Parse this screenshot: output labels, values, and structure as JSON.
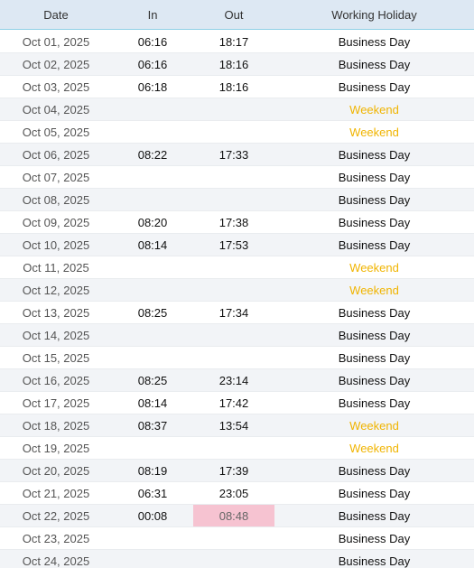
{
  "header": {
    "date": "Date",
    "in": "In",
    "out": "Out",
    "holiday": "Working Holiday"
  },
  "colors": {
    "header_bg": "#dde8f3",
    "header_border": "#8fd0e6",
    "weekend": "#f0b400",
    "flag": "#f6c3d1"
  },
  "rows": [
    {
      "date": "Oct 01, 2025",
      "in": "06:16",
      "out": "18:17",
      "holiday": "Business Day"
    },
    {
      "date": "Oct 02, 2025",
      "in": "06:16",
      "out": "18:16",
      "holiday": "Business Day"
    },
    {
      "date": "Oct 03, 2025",
      "in": "06:18",
      "out": "18:16",
      "holiday": "Business Day"
    },
    {
      "date": "Oct 04, 2025",
      "in": "",
      "out": "",
      "holiday": "Weekend"
    },
    {
      "date": "Oct 05, 2025",
      "in": "",
      "out": "",
      "holiday": "Weekend"
    },
    {
      "date": "Oct 06, 2025",
      "in": "08:22",
      "out": "17:33",
      "holiday": "Business Day"
    },
    {
      "date": "Oct 07, 2025",
      "in": "",
      "out": "",
      "holiday": "Business Day"
    },
    {
      "date": "Oct 08, 2025",
      "in": "",
      "out": "",
      "holiday": "Business Day"
    },
    {
      "date": "Oct 09, 2025",
      "in": "08:20",
      "out": "17:38",
      "holiday": "Business Day"
    },
    {
      "date": "Oct 10, 2025",
      "in": "08:14",
      "out": "17:53",
      "holiday": "Business Day"
    },
    {
      "date": "Oct 11, 2025",
      "in": "",
      "out": "",
      "holiday": "Weekend"
    },
    {
      "date": "Oct 12, 2025",
      "in": "",
      "out": "",
      "holiday": "Weekend"
    },
    {
      "date": "Oct 13, 2025",
      "in": "08:25",
      "out": "17:34",
      "holiday": "Business Day"
    },
    {
      "date": "Oct 14, 2025",
      "in": "",
      "out": "",
      "holiday": "Business Day"
    },
    {
      "date": "Oct 15, 2025",
      "in": "",
      "out": "",
      "holiday": "Business Day"
    },
    {
      "date": "Oct 16, 2025",
      "in": "08:25",
      "out": "23:14",
      "holiday": "Business Day"
    },
    {
      "date": "Oct 17, 2025",
      "in": "08:14",
      "out": "17:42",
      "holiday": "Business Day"
    },
    {
      "date": "Oct 18, 2025",
      "in": "08:37",
      "out": "13:54",
      "holiday": "Weekend"
    },
    {
      "date": "Oct 19, 2025",
      "in": "",
      "out": "",
      "holiday": "Weekend"
    },
    {
      "date": "Oct 20, 2025",
      "in": "08:19",
      "out": "17:39",
      "holiday": "Business Day"
    },
    {
      "date": "Oct 21, 2025",
      "in": "06:31",
      "out": "23:05",
      "holiday": "Business Day"
    },
    {
      "date": "Oct 22, 2025",
      "in": "00:08",
      "out": "08:48",
      "holiday": "Business Day",
      "out_flagged": true
    },
    {
      "date": "Oct 23, 2025",
      "in": "",
      "out": "",
      "holiday": "Business Day"
    },
    {
      "date": "Oct 24, 2025",
      "in": "",
      "out": "",
      "holiday": "Business Day"
    }
  ]
}
